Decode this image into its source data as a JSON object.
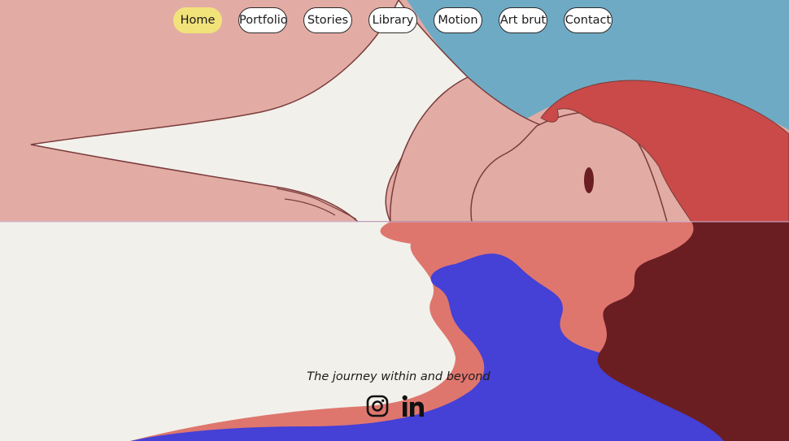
{
  "nav": {
    "items": [
      {
        "label": "Home",
        "active": true
      },
      {
        "label": "Portfolio",
        "active": false
      },
      {
        "label": "Stories",
        "active": false
      },
      {
        "label": "Library",
        "active": false
      },
      {
        "label": "Motion",
        "active": false
      },
      {
        "label": "Art brut",
        "active": false
      },
      {
        "label": "Contact",
        "active": false
      }
    ]
  },
  "hero": {
    "tagline": "The journey within and beyond"
  },
  "social": {
    "icons": [
      "instagram-icon",
      "linkedin-icon"
    ]
  },
  "colors": {
    "active_nav": "#f1e27a",
    "skin": "#e2aca4",
    "sky": "#6eaac4",
    "hair": "#c94a48",
    "cloth": "#f2f0ea",
    "water_blue": "#4540d6",
    "water_pink": "#de766e",
    "water_dark": "#6b1e22"
  }
}
